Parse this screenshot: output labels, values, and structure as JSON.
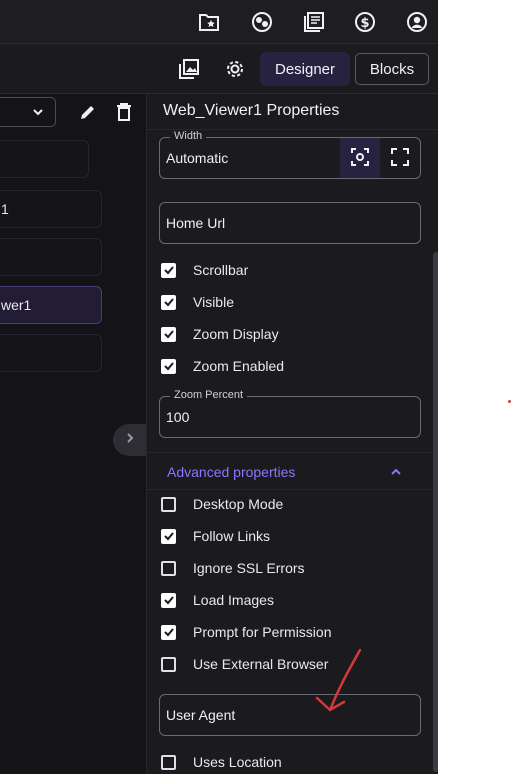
{
  "toolbar": {
    "icons": [
      "folder-star-icon",
      "face-user-icon",
      "book-icon",
      "dollar-icon",
      "account-icon"
    ]
  },
  "secondbar": {
    "designer_label": "Designer",
    "blocks_label": "Blocks",
    "icons": [
      "gallery-icon",
      "gear-icon"
    ]
  },
  "left": {
    "rows": [
      {
        "label": ""
      },
      {
        "label": "1"
      },
      {
        "label": ""
      },
      {
        "label": "wer1",
        "selected": true
      },
      {
        "label": ""
      }
    ]
  },
  "properties": {
    "title": "Web_Viewer1 Properties",
    "width": {
      "legend": "Width",
      "value": "Automatic"
    },
    "home_url": {
      "value": "Home Url"
    },
    "checkboxes_top": [
      {
        "label": "Scrollbar",
        "checked": true
      },
      {
        "label": "Visible",
        "checked": true
      },
      {
        "label": "Zoom Display",
        "checked": true
      },
      {
        "label": "Zoom Enabled",
        "checked": true
      }
    ],
    "zoom_percent": {
      "legend": "Zoom Percent",
      "value": "100"
    },
    "advanced_label": "Advanced properties",
    "checkboxes_adv": [
      {
        "label": "Desktop Mode",
        "checked": false
      },
      {
        "label": "Follow Links",
        "checked": true
      },
      {
        "label": "Ignore SSL Errors",
        "checked": false
      },
      {
        "label": "Load Images",
        "checked": true
      },
      {
        "label": "Prompt for Permission",
        "checked": true
      },
      {
        "label": "Use External Browser",
        "checked": false
      }
    ],
    "user_agent": {
      "value": "User Agent"
    },
    "uses_location": {
      "label": "Uses Location",
      "checked": false
    }
  },
  "colors": {
    "accent": "#8e74ff",
    "background": "#1a1a1f",
    "selected": "#27223f",
    "annotation": "#d43a3a"
  }
}
